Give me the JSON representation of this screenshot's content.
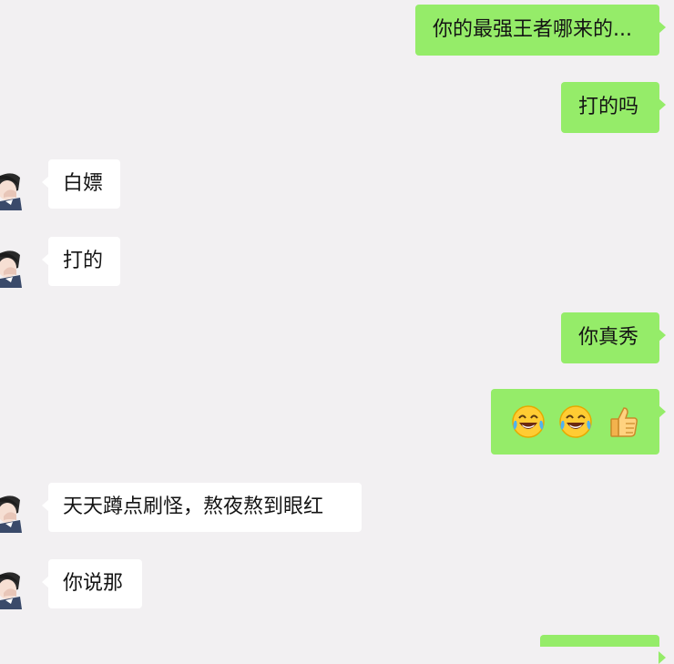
{
  "conversation": {
    "messages": [
      {
        "id": "m1",
        "side": "out",
        "text": "你的最强王者哪来的..."
      },
      {
        "id": "m2",
        "side": "out",
        "text": "打的吗"
      },
      {
        "id": "m3",
        "side": "in",
        "text": "白嫖"
      },
      {
        "id": "m4",
        "side": "in",
        "text": "打的"
      },
      {
        "id": "m5",
        "side": "out",
        "text": "你真秀"
      },
      {
        "id": "m6",
        "side": "out",
        "emojis": [
          "crying-laughing-face-icon",
          "crying-laughing-face-icon",
          "thumbs-up-icon"
        ]
      },
      {
        "id": "m7",
        "side": "in",
        "text": "天天蹲点刷怪，熬夜熬到眼红"
      },
      {
        "id": "m8",
        "side": "in",
        "text": "你说那"
      }
    ]
  },
  "colors": {
    "background": "#f2f0f2",
    "outgoing_bubble": "#95ec69",
    "incoming_bubble": "#ffffff",
    "text": "#141414"
  }
}
